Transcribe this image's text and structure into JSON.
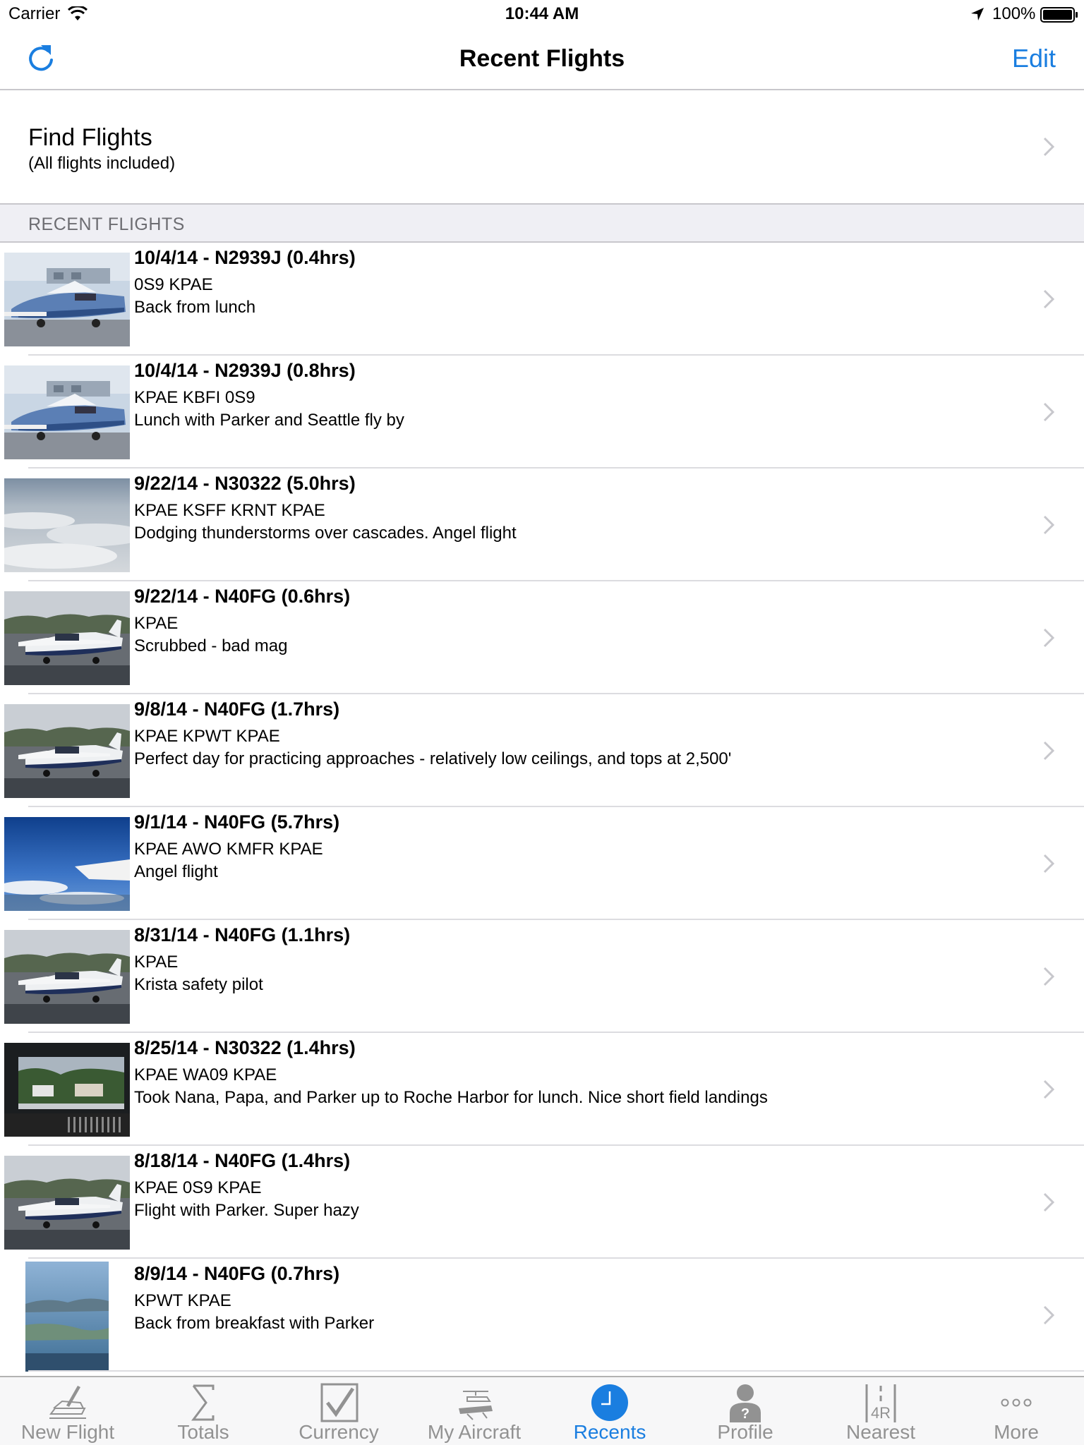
{
  "status_bar": {
    "carrier": "Carrier",
    "time": "10:44 AM",
    "battery": "100%"
  },
  "nav": {
    "title": "Recent Flights",
    "edit_label": "Edit"
  },
  "find": {
    "title": "Find Flights",
    "subtitle": "(All flights included)"
  },
  "section": {
    "label": "RECENT FLIGHTS"
  },
  "flights": [
    {
      "title": "10/4/14 - N2939J (0.4hrs)",
      "route": "0S9 KPAE",
      "comment": "Back from lunch",
      "photo": "piper-airplane-photo"
    },
    {
      "title": "10/4/14 - N2939J (0.8hrs)",
      "route": "KPAE KBFI 0S9",
      "comment": "Lunch with Parker and Seattle fly by",
      "photo": "piper-airplane-photo"
    },
    {
      "title": "9/22/14 - N30322 (5.0hrs)",
      "route": "KPAE KSFF KRNT KPAE",
      "comment": "Dodging thunderstorms over cascades. Angel flight",
      "photo": "clouds-photo"
    },
    {
      "title": "9/22/14 - N40FG (0.6hrs)",
      "route": "KPAE",
      "comment": "Scrubbed - bad mag",
      "photo": "mooney-airplane-photo"
    },
    {
      "title": "9/8/14 - N40FG (1.7hrs)",
      "route": "KPAE KPWT KPAE",
      "comment": "Perfect day for practicing approaches - relatively low ceilings, and tops at 2,500'",
      "photo": "mooney-airplane-photo"
    },
    {
      "title": "9/1/14 - N40FG (5.7hrs)",
      "route": "KPAE AWO KMFR KPAE",
      "comment": "Angel flight",
      "photo": "sky-wing-photo"
    },
    {
      "title": "8/31/14 - N40FG (1.1hrs)",
      "route": "KPAE",
      "comment": "Krista safety pilot",
      "photo": "mooney-airplane-photo"
    },
    {
      "title": "8/25/14 - N30322 (1.4hrs)",
      "route": "KPAE WA09 KPAE",
      "comment": "Took Nana, Papa, and Parker up to Roche Harbor for lunch.  Nice short field landings",
      "photo": "harbor-photo"
    },
    {
      "title": "8/18/14 - N40FG (1.4hrs)",
      "route": "KPAE 0S9 KPAE",
      "comment": "Flight with Parker. Super hazy",
      "photo": "mooney-airplane-photo"
    },
    {
      "title": "8/9/14 - N40FG (0.7hrs)",
      "route": "KPWT KPAE",
      "comment": "Back from breakfast with Parker",
      "photo": "aerial-water-photo"
    }
  ],
  "tabs": [
    {
      "label": "New Flight",
      "icon": "new-flight-icon",
      "active": false
    },
    {
      "label": "Totals",
      "icon": "sigma-icon",
      "active": false
    },
    {
      "label": "Currency",
      "icon": "checkmark-icon",
      "active": false
    },
    {
      "label": "My Aircraft",
      "icon": "aircraft-icon",
      "active": false
    },
    {
      "label": "Recents",
      "icon": "clock-icon",
      "active": true
    },
    {
      "label": "Profile",
      "icon": "profile-icon",
      "active": false
    },
    {
      "label": "Nearest",
      "icon": "runway-icon",
      "runway_number": "4R",
      "active": false
    },
    {
      "label": "More",
      "icon": "more-icon",
      "active": false
    }
  ],
  "colors": {
    "accent": "#1a7ee0",
    "inactive_tab": "#929292",
    "section_bg": "#efeff4"
  }
}
